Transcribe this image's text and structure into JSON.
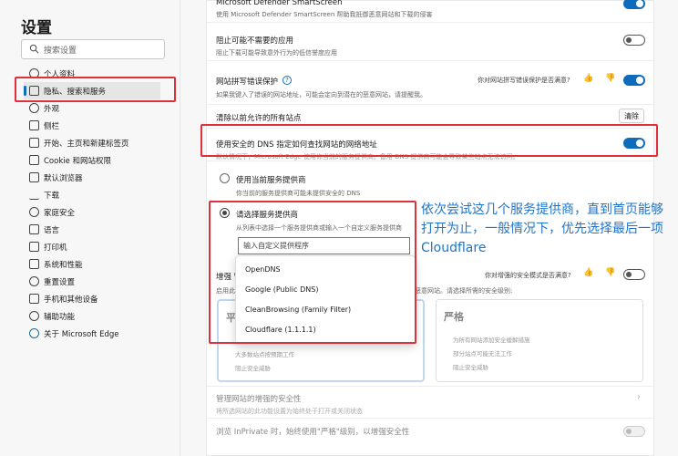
{
  "sidebar": {
    "title": "设置",
    "search_placeholder": "搜索设置",
    "items": [
      {
        "label": "个人资料",
        "icon": "profile-icon"
      },
      {
        "label": "隐私、搜索和服务",
        "icon": "lock-icon",
        "active": true
      },
      {
        "label": "外观",
        "icon": "appearance-icon"
      },
      {
        "label": "侧栏",
        "icon": "sidebar-icon"
      },
      {
        "label": "开始、主页和新建标签页",
        "icon": "home-icon"
      },
      {
        "label": "Cookie 和网站权限",
        "icon": "cookie-icon"
      },
      {
        "label": "默认浏览器",
        "icon": "browser-icon"
      },
      {
        "label": "下载",
        "icon": "download-icon"
      },
      {
        "label": "家庭安全",
        "icon": "family-icon"
      },
      {
        "label": "语言",
        "icon": "language-icon"
      },
      {
        "label": "打印机",
        "icon": "printer-icon"
      },
      {
        "label": "系统和性能",
        "icon": "system-icon"
      },
      {
        "label": "重置设置",
        "icon": "reset-icon"
      },
      {
        "label": "手机和其他设备",
        "icon": "phone-icon"
      },
      {
        "label": "辅助功能",
        "icon": "accessibility-icon"
      },
      {
        "label": "关于 Microsoft Edge",
        "icon": "edge-icon"
      }
    ]
  },
  "main": {
    "smartscreen": {
      "title": "Microsoft Defender SmartScreen",
      "desc": "使用 Microsoft Defender SmartScreen 帮助我抵御恶意网站和下载的侵害"
    },
    "block_apps": {
      "title": "阻止可能不需要的应用",
      "desc": "阻止下载可能导致意外行为的低信誉度应用"
    },
    "typo": {
      "title": "网站拼写错误保护",
      "help": "?",
      "desc": "如果我键入了错误的网站地址，可能会定向到潜在的恶意网站，请提醒我。",
      "feedback": "你对网站拼写错误保护是否满意?"
    },
    "clear_sites": {
      "title": "清除以前允许的所有站点",
      "button": "清除"
    },
    "dns": {
      "title": "使用安全的 DNS 指定如何查找网站的网络地址",
      "desc": "默认情况下，Microsoft Edge 使用你当前的服务提供商。备用 DNS 提供商可能会导致某些站点无法访问。",
      "option_current": {
        "label": "使用当前服务提供商",
        "desc": "你当前的服务提供商可能未提供安全的 DNS"
      },
      "option_custom": {
        "label": "请选择服务提供商",
        "desc": "从列表中选择一个服务提供商或输入一个自定义服务提供商"
      },
      "input_placeholder": "输入自定义提供程序",
      "providers": [
        "OpenDNS",
        "Google (Public DNS)",
        "CleanBrowsing (Family Filter)",
        "Cloudflare (1.1.1.1)"
      ]
    },
    "enhanced": {
      "title": "增强 Web 安全性",
      "desc": "启用此",
      "desc_tail": "恶意网站。请选择所需的安全级别:",
      "feedback": "你对增强的安全模式是否满意?",
      "card_balanced": {
        "title": "平衡",
        "bullets": [
          "推荐",
          "大多数站点按预期工作",
          "阻止安全威胁"
        ]
      },
      "card_strict": {
        "title": "严格",
        "bullets": [
          "为所有网站添加安全缓解措施",
          "部分站点可能无法工作",
          "阻止安全威胁"
        ]
      }
    },
    "manage": {
      "title": "管理网站的增强的安全性",
      "desc": "将所选网站的此功能设置为始终处于打开或关闭状态"
    },
    "inprivate": {
      "title": "浏览 InPrivate 时，始终使用\"严格\"级别，以增强安全性"
    }
  },
  "annotation": {
    "text": "依次尝试这几个服务提供商，直到首页能够打开为止，一般情况下，优先选择最后一项Cloudflare",
    "color": "#1e74c9"
  },
  "colors": {
    "accent": "#0f6cbd",
    "highlight": "#e0303a"
  }
}
